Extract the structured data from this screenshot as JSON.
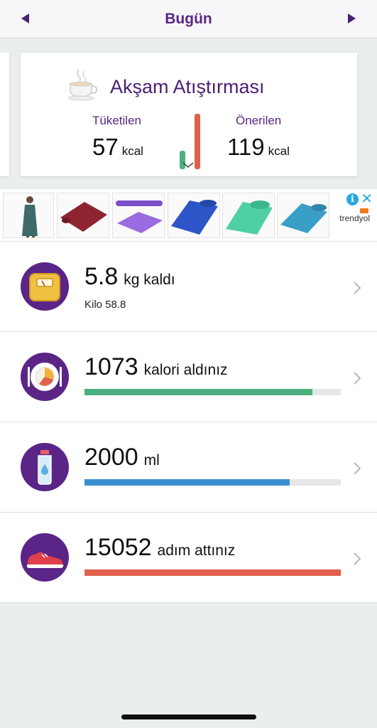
{
  "header": {
    "title": "Bugün"
  },
  "meal_card": {
    "title": "Akşam Atıştırması",
    "consumed_label": "Tüketilen",
    "consumed_value": "57",
    "consumed_unit": "kcal",
    "recommended_label": "Önerilen",
    "recommended_value": "119",
    "recommended_unit": "kcal"
  },
  "ad": {
    "brand": "trendyol",
    "info_glyph": "i",
    "close_glyph": "✕"
  },
  "rows": [
    {
      "icon": "scale-icon",
      "value": "5.8",
      "unit": "kg kaldı",
      "sub": "Kilo 58.8"
    },
    {
      "icon": "plate-icon",
      "value": "1073",
      "unit": "kalori aldınız",
      "progress": 0.89,
      "color": "#4caf7f"
    },
    {
      "icon": "water-bottle-icon",
      "value": "2000",
      "unit": "ml",
      "progress": 0.8,
      "color": "#3a8fd1"
    },
    {
      "icon": "sneaker-icon",
      "value": "15052",
      "unit": "adım attınız",
      "progress": 1.0,
      "color": "#e0604d"
    }
  ],
  "colors": {
    "brand_purple": "#5a2586",
    "header_bg": "#f7f7f9",
    "page_bg": "#ebeeef"
  }
}
